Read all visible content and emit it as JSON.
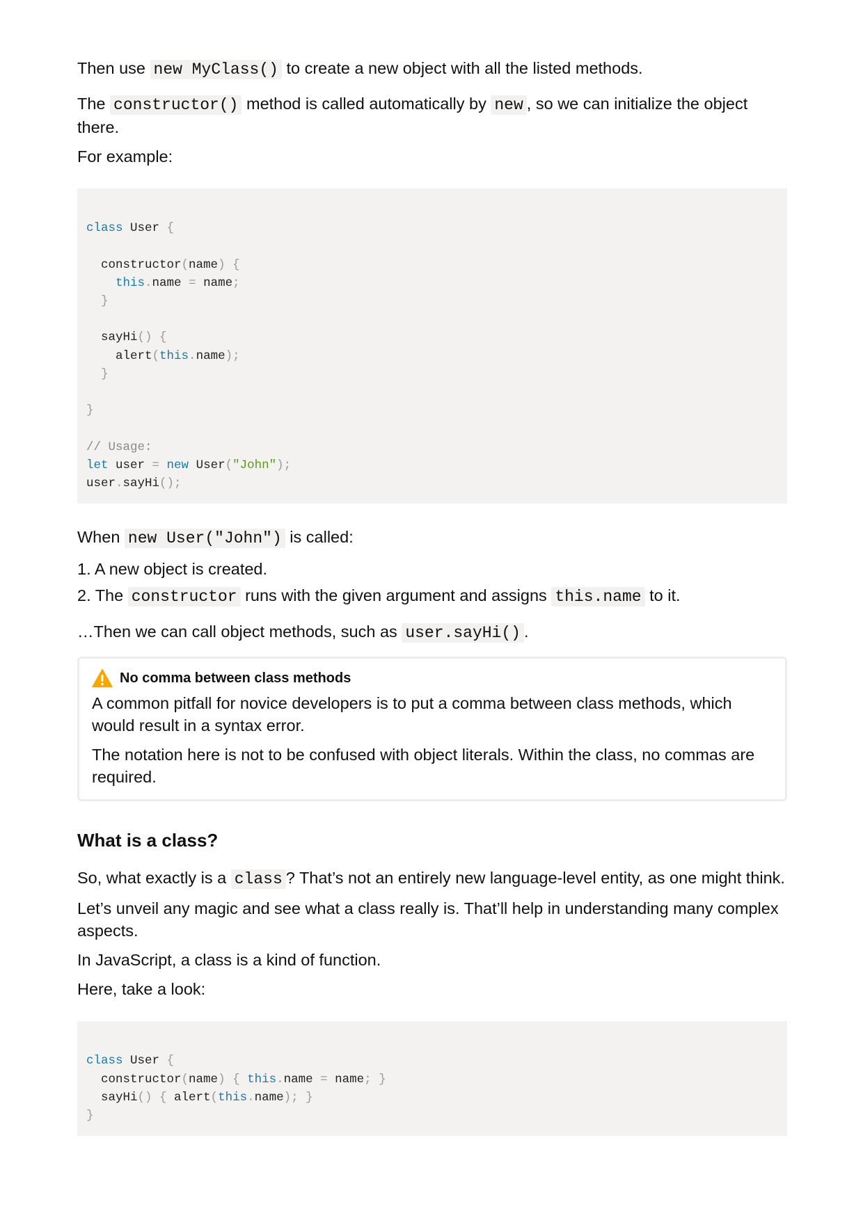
{
  "intro": {
    "p1_before": "Then use ",
    "p1_code": "new MyClass()",
    "p1_after": " to create a new object with all the listed methods.",
    "p2_before": "The ",
    "p2_code1": "constructor()",
    "p2_mid": " method is called automatically by ",
    "p2_code2": "new",
    "p2_after": ", so we can initialize the object there.",
    "p3": "For example:"
  },
  "code1": {
    "l1_kw": "class",
    "l1_name": " User ",
    "l1_p": "{",
    "l3_name": "  constructor",
    "l3_p1": "(",
    "l3_arg": "name",
    "l3_p2": ") {",
    "l4_indent": "    ",
    "l4_kw": "this",
    "l4_dot": ".",
    "l4_name": "name ",
    "l4_eq": "=",
    "l4_val": " name",
    "l4_semi": ";",
    "l5_p": "  }",
    "l7_name": "  sayHi",
    "l7_p": "() {",
    "l8_name": "    alert",
    "l8_p1": "(",
    "l8_kw": "this",
    "l8_dot": ".",
    "l8_prop": "name",
    "l8_p2": ");",
    "l9_p": "  }",
    "l11_p": "}",
    "l13_cm": "// Usage:",
    "l14_kw": "let",
    "l14_name": " user ",
    "l14_eq": "=",
    "l14_kw2": " new",
    "l14_cls": " User",
    "l14_p1": "(",
    "l14_str": "\"John\"",
    "l14_p2": ");",
    "l15_name": "user",
    "l15_dot": ".",
    "l15_method": "sayHi",
    "l15_p": "();"
  },
  "after": {
    "p4_before": "When ",
    "p4_code": "new User(\"John\")",
    "p4_after": " is called:",
    "li1": "1. A new object is created.",
    "li2_before": "2. The ",
    "li2_code1": "constructor",
    "li2_mid": " runs with the given argument and assigns ",
    "li2_code2": "this.name",
    "li2_after": " to it.",
    "p5_before": "…Then we can call object methods, such as ",
    "p5_code": "user.sayHi()",
    "p5_after": "."
  },
  "warning": {
    "icon": "warning-icon",
    "title": "No comma between class methods",
    "p1": "A common pitfall for novice developers is to put a comma between class methods, which would result in a syntax error.",
    "p2": "The notation here is not to be confused with object literals. Within the class, no commas are required.",
    "accent": "#f5a800"
  },
  "section": {
    "heading": "What is a class?",
    "p1_before": "So, what exactly is a ",
    "p1_code": "class",
    "p1_after": "? That’s not an entirely new language-level entity, as one might think.",
    "p2": "Let’s unveil any magic and see what a class really is. That’ll help in understanding many complex aspects.",
    "p3": "In JavaScript, a class is a kind of function.",
    "p4": "Here, take a look:"
  },
  "code2": {
    "l1_kw": "class",
    "l1_name": " User ",
    "l1_p": "{",
    "l2_name": "  constructor",
    "l2_p1": "(",
    "l2_arg": "name",
    "l2_p2": ") { ",
    "l2_kw": "this",
    "l2_dot": ".",
    "l2_prop": "name ",
    "l2_eq": "=",
    "l2_val": " name",
    "l2_p3": "; }",
    "l3_name": "  sayHi",
    "l3_p1": "() { ",
    "l3_fn": "alert",
    "l3_p2": "(",
    "l3_kw": "this",
    "l3_dot": ".",
    "l3_prop": "name",
    "l3_p3": "); }",
    "l4_p": "}"
  },
  "colors": {
    "keyword": "#1a7ba8",
    "string": "#5a9a1a",
    "code_bg": "#f4f2f0"
  }
}
